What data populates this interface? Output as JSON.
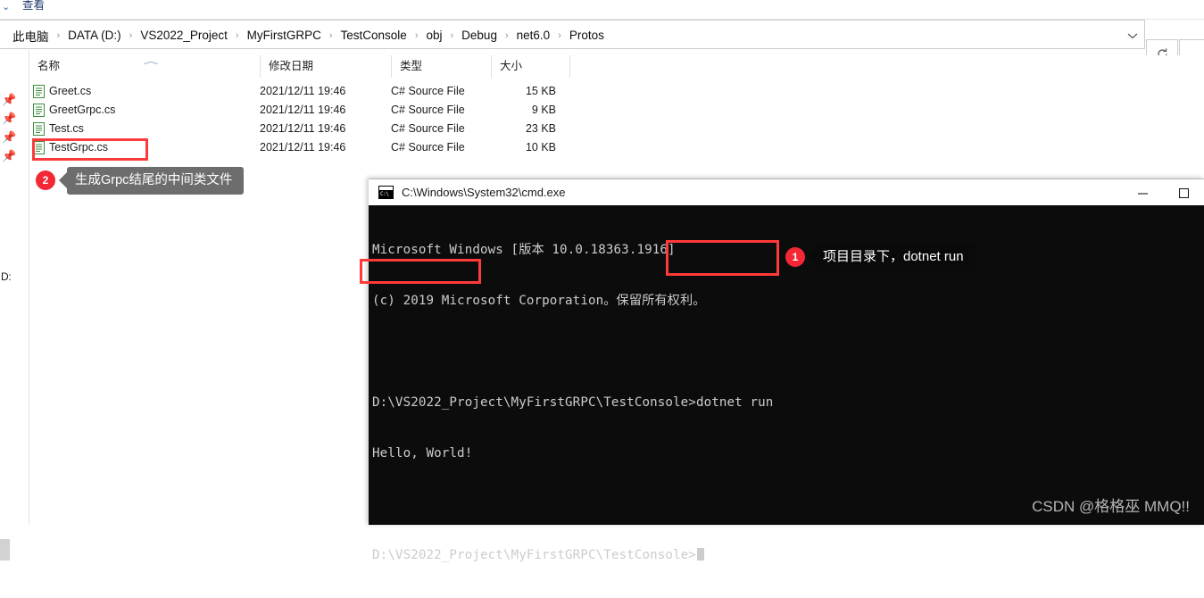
{
  "explorer": {
    "menu": {
      "view_label": "查看",
      "caret_icon": "chevron-down-icon"
    },
    "address": {
      "breadcrumb": [
        "此电脑",
        "DATA (D:)",
        "VS2022_Project",
        "MyFirstGRPC",
        "TestConsole",
        "obj",
        "Debug",
        "net6.0",
        "Protos"
      ],
      "separator": "›",
      "dropdown_icon": "chevron-down-icon",
      "refresh_icon": "refresh-icon"
    },
    "navpane": {
      "drive_label": "D:",
      "pin_icon": "pin-icon",
      "pin_count": 4
    },
    "columns": [
      {
        "key": "name",
        "label": "名称",
        "sorted": "asc",
        "sort_icon": "chevron-up-icon"
      },
      {
        "key": "date",
        "label": "修改日期"
      },
      {
        "key": "type",
        "label": "类型"
      },
      {
        "key": "size",
        "label": "大小"
      }
    ],
    "files": [
      {
        "icon": "csharp-source-file-icon",
        "name": "Greet.cs",
        "date": "2021/12/11 19:46",
        "type": "C# Source File",
        "size": "15 KB"
      },
      {
        "icon": "csharp-source-file-icon",
        "name": "GreetGrpc.cs",
        "date": "2021/12/11 19:46",
        "type": "C# Source File",
        "size": "9 KB"
      },
      {
        "icon": "csharp-source-file-icon",
        "name": "Test.cs",
        "date": "2021/12/11 19:46",
        "type": "C# Source File",
        "size": "23 KB"
      },
      {
        "icon": "csharp-source-file-icon",
        "name": "TestGrpc.cs",
        "date": "2021/12/11 19:46",
        "type": "C# Source File",
        "size": "10 KB"
      }
    ]
  },
  "cmd": {
    "icon": "cmd-console-icon",
    "title": "C:\\Windows\\System32\\cmd.exe",
    "buttons": {
      "minimize_icon": "minimize-icon",
      "maximize_icon": "maximize-icon"
    },
    "lines": {
      "l1": "Microsoft Windows [版本 10.0.18363.1916]",
      "l2": "(c) 2019 Microsoft Corporation。保留所有权利。",
      "l3": "D:\\VS2022_Project\\MyFirstGRPC\\TestConsole>dotnet run",
      "l4": "Hello, World!",
      "l5": "D:\\VS2022_Project\\MyFirstGRPC\\TestConsole>"
    }
  },
  "annotations": {
    "callout1": {
      "number": "1",
      "text": "项目目录下，dotnet run"
    },
    "callout2": {
      "number": "2",
      "text": "生成Grpc结尾的中间类文件"
    },
    "highlight_color": "#fb3b3b",
    "badge_color": "#f32735"
  },
  "watermark": {
    "text": "CSDN @格格巫 MMQ!!"
  }
}
